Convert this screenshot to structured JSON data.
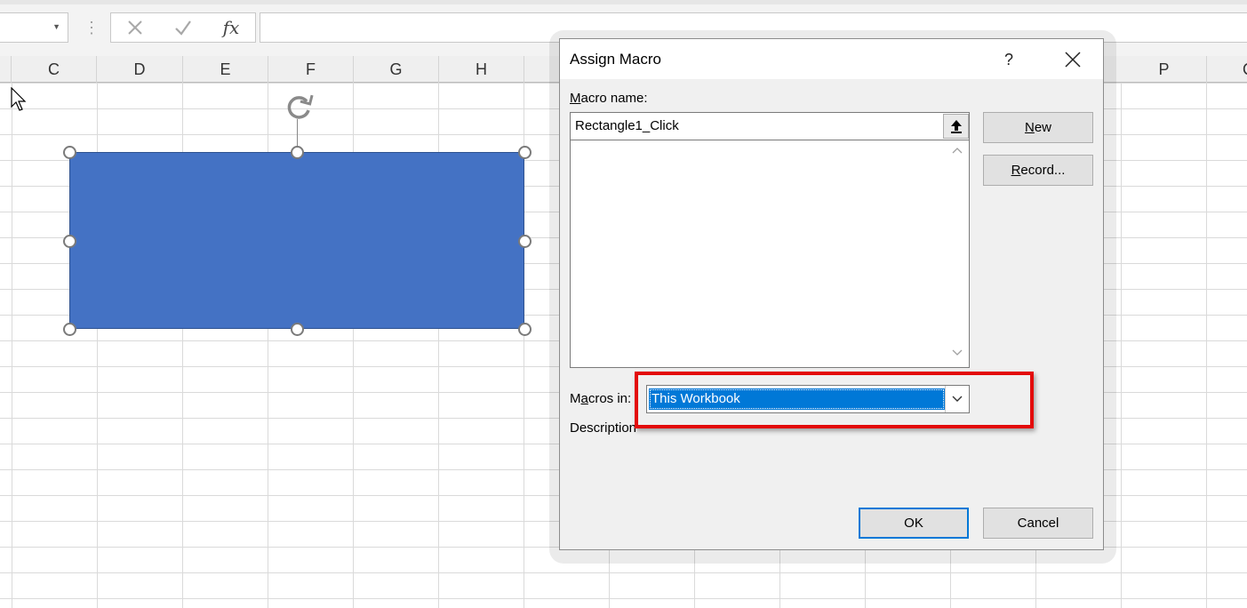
{
  "formula_bar": {
    "fx_label": "fx"
  },
  "columns": [
    "C",
    "D",
    "E",
    "F",
    "G",
    "H",
    "P",
    "Q"
  ],
  "dialog": {
    "title": "Assign Macro",
    "help": "?",
    "macro_name_label_accel": "M",
    "macro_name_label_rest": "acro name:",
    "macro_name_value": "Rectangle1_Click",
    "macros_in_label_pre": "M",
    "macros_in_label_accel": "a",
    "macros_in_label_rest": "cros in:",
    "macros_in_value": "This Workbook",
    "description_label": "Description",
    "buttons": {
      "new_accel": "N",
      "new_rest": "ew",
      "record_accel": "R",
      "record_rest": "ecord...",
      "ok": "OK",
      "cancel": "Cancel"
    }
  },
  "colors": {
    "shape_fill": "#4472c4",
    "highlight": "#e30b0b",
    "selection": "#0078d7"
  }
}
